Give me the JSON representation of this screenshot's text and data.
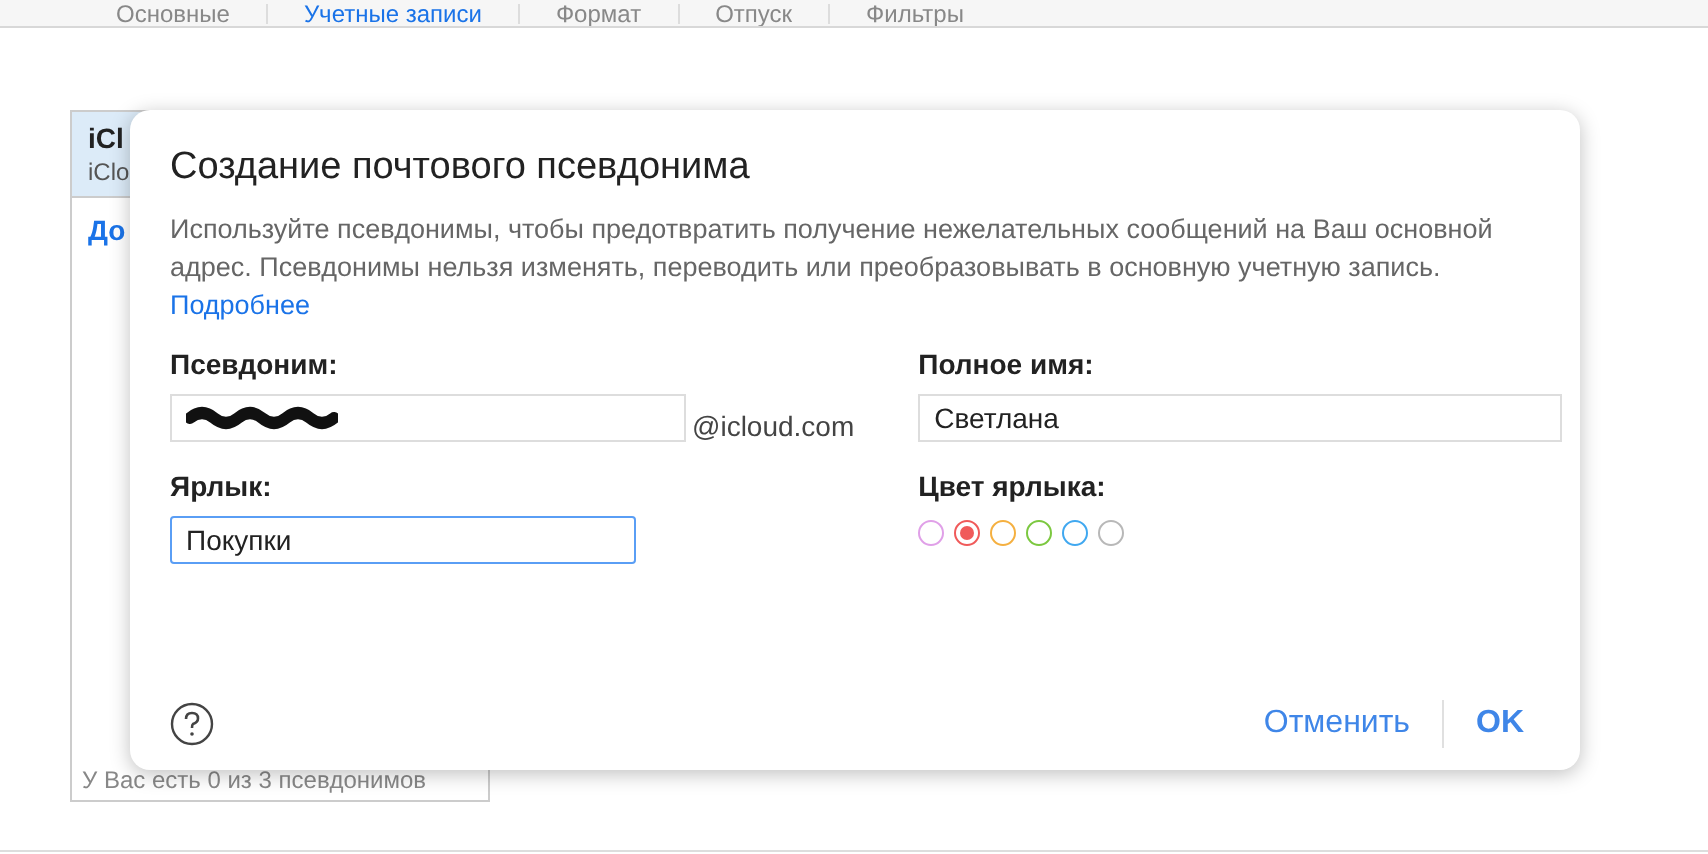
{
  "tabs": [
    {
      "label": "Основные",
      "selected": false
    },
    {
      "label": "Учетные записи",
      "selected": true
    },
    {
      "label": "Формат",
      "selected": false
    },
    {
      "label": "Отпуск",
      "selected": false
    },
    {
      "label": "Фильтры",
      "selected": false
    }
  ],
  "accounts": {
    "item_title": "iCl",
    "item_subtitle": "iClo",
    "add_link": "До",
    "footer": "У Вас есть 0 из 3 псевдонимов"
  },
  "dialog": {
    "title": "Создание почтового псевдонима",
    "description": "Используйте псевдонимы, чтобы предотвратить получение нежелательных сообщений на Ваш основной адрес. Псевдонимы нельзя изменять, переводить или преобразовывать в основную учетную запись.",
    "more_link": "Подробнее",
    "alias_label": "Псевдоним:",
    "alias_domain": "@icloud.com",
    "full_name_label": "Полное имя:",
    "full_name_value": "Светлана",
    "tag_label": "Ярлык:",
    "tag_value": "Покупки",
    "tag_color_label": "Цвет ярлыка:",
    "colors": [
      {
        "color": "#e0a0e8",
        "selected": false
      },
      {
        "color": "#f05a5a",
        "selected": true
      },
      {
        "color": "#f5b040",
        "selected": false
      },
      {
        "color": "#7cc840",
        "selected": false
      },
      {
        "color": "#40a8f0",
        "selected": false
      },
      {
        "color": "#b8b8b8",
        "selected": false
      }
    ],
    "cancel": "Отменить",
    "ok": "OK"
  }
}
